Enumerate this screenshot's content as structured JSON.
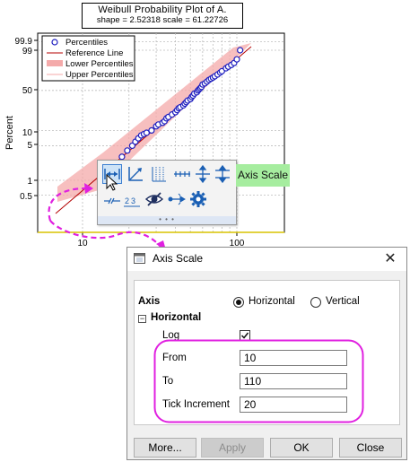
{
  "plot": {
    "title": "Weibull Probability Plot of A.",
    "stats": "shape = 2.52318  scale = 61.22726",
    "ylabel": "Percent",
    "legend": [
      "Percentiles",
      "Reference Line",
      "Lower Percentiles",
      "Upper Percentiles"
    ],
    "yticks": [
      "99.9",
      "99",
      "50",
      "10",
      "5",
      "1",
      "0.5"
    ],
    "xticks": [
      "10",
      "100"
    ],
    "colors": {
      "points": "#1f1fbf",
      "reference": "#b40000",
      "band": "#f4aaaa",
      "callout": "#e020e0"
    }
  },
  "chart_data": {
    "type": "scatter",
    "title": "Weibull Probability Plot of A.",
    "subtitle": "shape = 2.52318  scale = 61.22726",
    "ylabel": "Percent",
    "xscale": "log",
    "yscale": "weibull probability",
    "grid": true,
    "legend_position": "top-left",
    "yticks": [
      0.5,
      1,
      5,
      10,
      50,
      99,
      99.9
    ],
    "xticks": [
      10,
      100
    ],
    "series": [
      {
        "name": "Percentiles",
        "x": [
          18,
          19.5,
          21,
          22,
          23,
          24,
          25,
          26,
          28,
          30,
          31,
          33,
          34,
          35,
          36,
          38,
          40,
          41,
          42,
          43,
          45,
          46,
          47,
          48,
          50,
          51,
          52,
          53,
          55,
          56,
          57,
          58,
          59,
          60,
          62,
          64,
          66,
          68,
          70,
          72,
          75,
          78,
          80,
          85,
          88,
          92,
          96,
          100,
          105
        ],
        "y": [
          3,
          4,
          5,
          6,
          7,
          8,
          8.5,
          9,
          10,
          12,
          13,
          14,
          15,
          17,
          18,
          20,
          22,
          24,
          26,
          27,
          29,
          31,
          33,
          35,
          37,
          40,
          42,
          45,
          47,
          50,
          52,
          54,
          56,
          60,
          62,
          65,
          68,
          70,
          72,
          74,
          77,
          80,
          82,
          86,
          88,
          90,
          92,
          95,
          99
        ]
      },
      {
        "name": "Reference Line",
        "x": [
          10,
          110
        ],
        "y": [
          0.5,
          99.9
        ]
      },
      {
        "name": "Lower Percentiles",
        "x": [
          10,
          110
        ],
        "y": [
          0.3,
          99
        ]
      },
      {
        "name": "Upper Percentiles",
        "x": [
          10,
          110
        ],
        "y": [
          2,
          99.9
        ]
      }
    ]
  },
  "mini_toolbar": {
    "tooltip": "Axis Scale",
    "icons": [
      "axis-scale-icon",
      "axis-type-icon",
      "grid-lines-icon",
      "tick-labels-icon",
      "x-axis-position-icon",
      "y-axis-position-icon",
      "axis-breaks-icon",
      "reverse-axis-icon",
      "show-hide-icon",
      "arrow-icon",
      "settings-gear-icon"
    ],
    "footer": "• • •"
  },
  "dialog": {
    "title": "Axis Scale",
    "close_glyph": "✕",
    "axis_label": "Axis",
    "radio_horizontal": "Horizontal",
    "radio_vertical": "Vertical",
    "section_label": "Horizontal",
    "collapse_glyph": "−",
    "log_label": "Log",
    "log_checked": true,
    "from_label": "From",
    "from_value": "10",
    "to_label": "To",
    "to_value": "110",
    "tick_label": "Tick Increment",
    "tick_value": "20",
    "buttons": {
      "more": "More...",
      "apply": "Apply",
      "ok": "OK",
      "close": "Close"
    }
  }
}
